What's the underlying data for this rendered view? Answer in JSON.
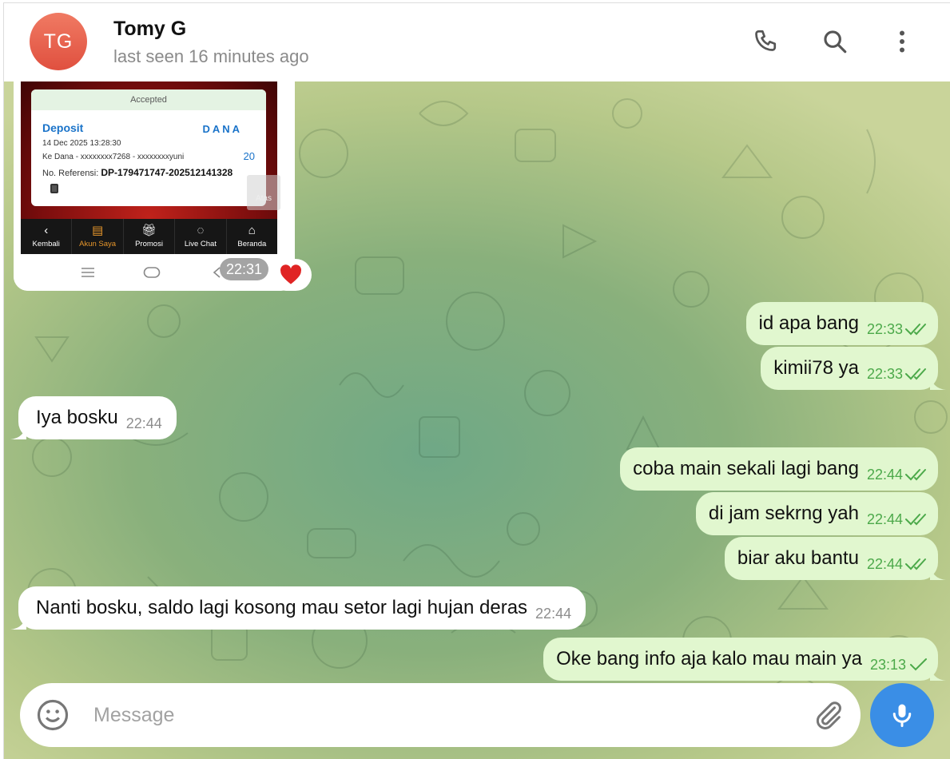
{
  "header": {
    "avatar_initials": "TG",
    "contact_name": "Tomy G",
    "status": "last seen 16 minutes ago",
    "icons": [
      "phone-icon",
      "search-icon",
      "more-vertical-icon"
    ]
  },
  "photo_message": {
    "screenshot": {
      "accepted": "Accepted",
      "title": "Deposit",
      "wallet": "DANA",
      "date": "14 Dec 2025 13:28:30",
      "recipient": "Ke Dana - xxxxxxxx7268 - xxxxxxxxyuni",
      "amount": "20",
      "reference_label": "No. Referensi:",
      "reference_value": "DP-179471747-202512141328",
      "scroll_top_label": "Atas",
      "nav": [
        "Kembali",
        "Akun Saya",
        "Promosi",
        "Live Chat",
        "Beranda"
      ]
    },
    "time": "22:31",
    "reaction": "❤️"
  },
  "messages": [
    {
      "dir": "out",
      "text": "id apa bang",
      "time": "22:33",
      "ticks": "double"
    },
    {
      "dir": "out",
      "text": "kimii78 ya",
      "time": "22:33",
      "ticks": "double"
    },
    {
      "dir": "in",
      "text": "Iya bosku",
      "time": "22:44"
    },
    {
      "dir": "out",
      "text": "coba main sekali lagi bang",
      "time": "22:44",
      "ticks": "double"
    },
    {
      "dir": "out",
      "text": "di jam sekrng yah",
      "time": "22:44",
      "ticks": "double"
    },
    {
      "dir": "out",
      "text": "biar aku bantu",
      "time": "22:44",
      "ticks": "double"
    },
    {
      "dir": "in",
      "text": "Nanti bosku, saldo lagi kosong mau setor lagi hujan deras",
      "time": "22:44"
    },
    {
      "dir": "out",
      "text": "Oke bang info aja kalo mau main ya",
      "time": "23:13",
      "ticks": "single"
    }
  ],
  "composer": {
    "placeholder": "Message",
    "icons": [
      "emoji-icon",
      "attach-icon",
      "microphone-icon"
    ]
  },
  "colors": {
    "avatar": "#e0503f",
    "outgoing_bubble": "#e1f7cf",
    "tick_green": "#4ca94a",
    "mic_button": "#3a8ee6"
  }
}
